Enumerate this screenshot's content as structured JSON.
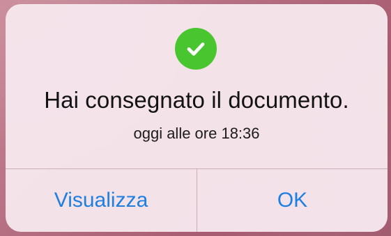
{
  "colors": {
    "accent": "#1f7fe0",
    "success": "#49c62f",
    "dialog_background": "#f6e6ec",
    "title": "#121212"
  },
  "alert": {
    "icon": "check-icon",
    "title": "Hai consegnato il documento.",
    "subtitle": "oggi alle ore 18:36",
    "actions": {
      "view": "Visualizza",
      "ok": "OK"
    }
  }
}
